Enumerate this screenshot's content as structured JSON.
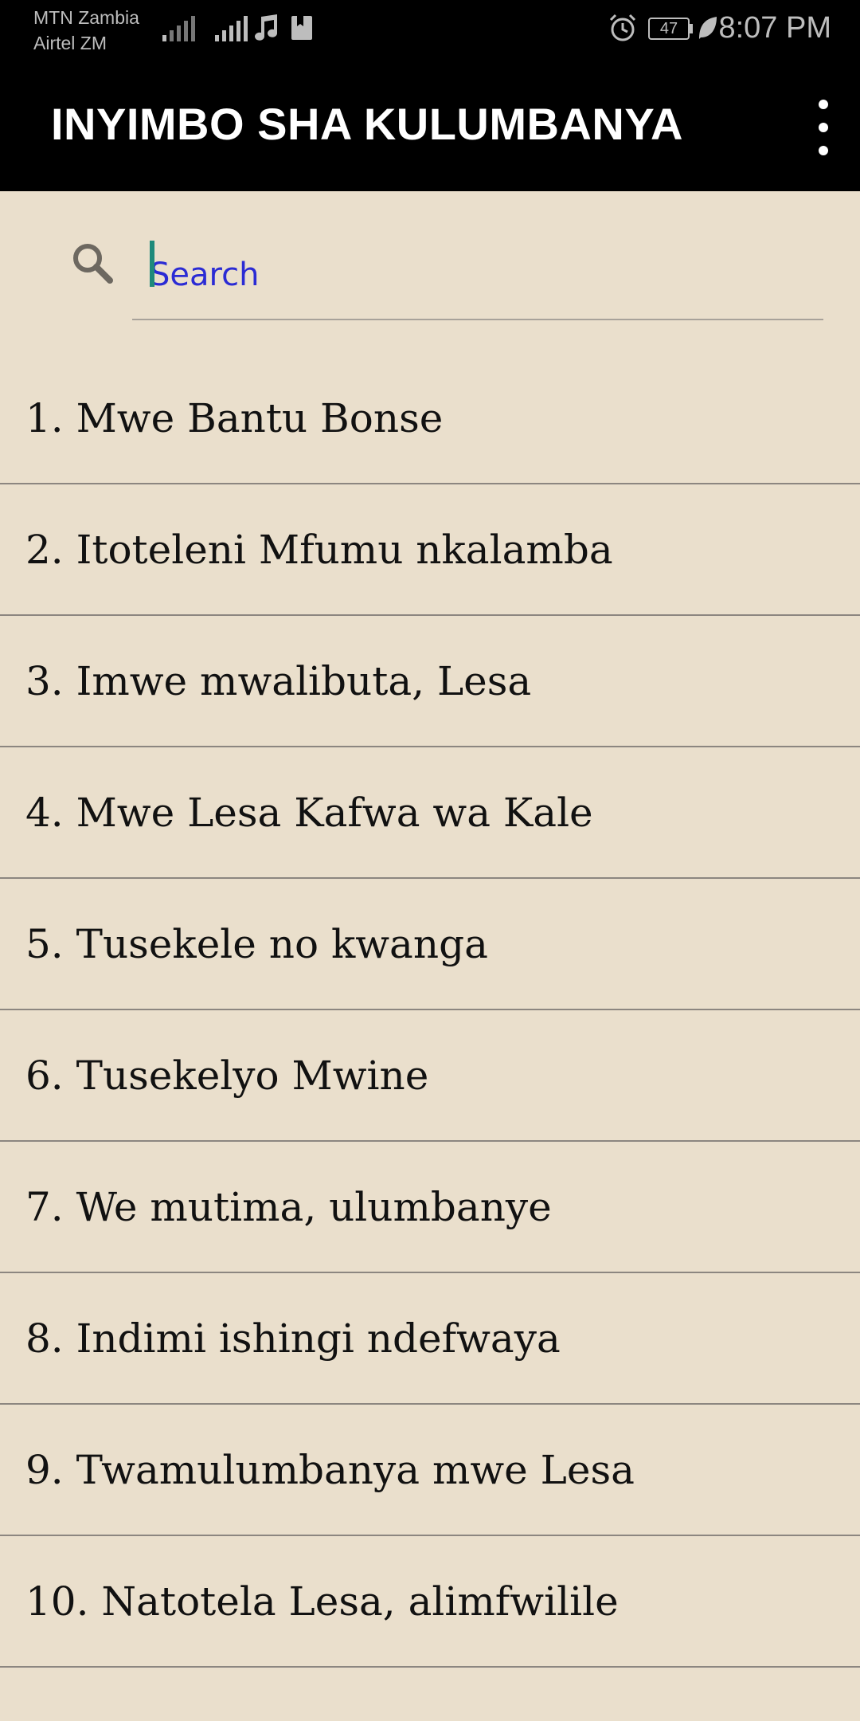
{
  "status_bar": {
    "carrier_1": "MTN Zambia",
    "carrier_2": "Airtel ZM",
    "battery": "47",
    "time": "8:07 PM",
    "icons": [
      "signal-icon",
      "signal-icon",
      "music-note-icon",
      "notification-icon",
      "alarm-icon",
      "battery-icon",
      "leaf-icon"
    ]
  },
  "app_bar": {
    "title": "INYIMBO SHA KULUMBANYA",
    "menu_icon": "more-vert-icon"
  },
  "search": {
    "placeholder": "Search",
    "value": "",
    "icon": "search-icon"
  },
  "songs": [
    {
      "label": "1. Mwe Bantu Bonse"
    },
    {
      "label": "2. Itoteleni Mfumu nkalamba"
    },
    {
      "label": "3. Imwe mwalibuta, Lesa"
    },
    {
      "label": "4. Mwe Lesa Kafwa wa Kale"
    },
    {
      "label": "5. Tusekele no kwanga"
    },
    {
      "label": "6. Tusekelyo Mwine"
    },
    {
      "label": "7. We mutima, ulumbanye"
    },
    {
      "label": "8. Indimi ishingi ndefwaya"
    },
    {
      "label": "9. Twamulumbanya mwe Lesa"
    },
    {
      "label": "10. Natotela Lesa, alimfwilile"
    }
  ],
  "colors": {
    "background": "#EADFCC",
    "app_bar": "#000000",
    "divider": "#8C8680",
    "placeholder": "#2B2BD4",
    "cursor": "#1E8A7A"
  }
}
